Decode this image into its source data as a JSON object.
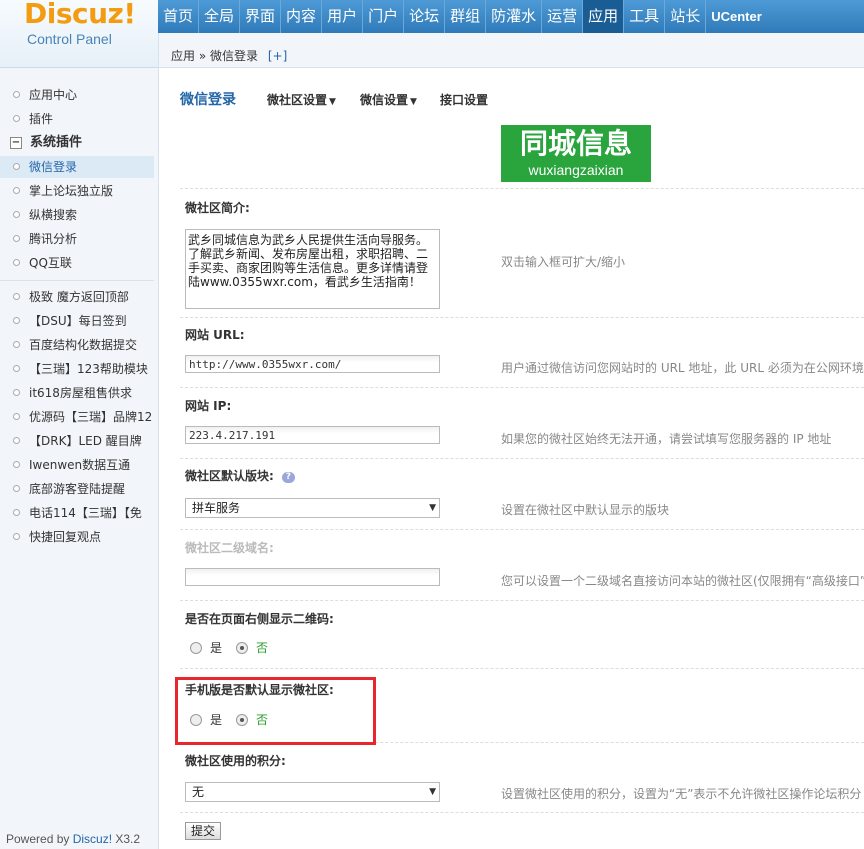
{
  "logo": {
    "brand": "Discuz!",
    "subtitle": "Control Panel"
  },
  "topnav": [
    {
      "label": "首页"
    },
    {
      "label": "全局"
    },
    {
      "label": "界面"
    },
    {
      "label": "内容"
    },
    {
      "label": "用户"
    },
    {
      "label": "门户"
    },
    {
      "label": "论坛"
    },
    {
      "label": "群组"
    },
    {
      "label": "防灌水"
    },
    {
      "label": "运营"
    },
    {
      "label": "应用",
      "active": true
    },
    {
      "label": "工具"
    },
    {
      "label": "站长"
    },
    {
      "label": "UCenter"
    }
  ],
  "breadcrumb": {
    "part1": "应用",
    "sep": "»",
    "part2": "微信登录",
    "plus": "[+]"
  },
  "sidebar": {
    "items_top": [
      "应用中心",
      "插件"
    ],
    "group_label": "系统插件",
    "group_toggle": "−",
    "items_system": [
      "微信登录",
      "掌上论坛独立版",
      "纵横搜索",
      "腾讯分析",
      "QQ互联"
    ],
    "items_plugins": [
      "极致 魔方返回顶部",
      "【DSU】每日签到",
      "百度结构化数据提交",
      "【三瑞】123帮助模块",
      "it618房屋租售供求",
      "优源码【三瑞】品牌12",
      "【DRK】LED 醒目牌",
      "Iwenwen数据互通",
      "底部游客登陆提醒",
      "电话114【三瑞】【免",
      "快捷回复观点"
    ],
    "active": "微信登录"
  },
  "footer": {
    "prefix": "Powered by ",
    "brand": "Discuz!",
    "version": " X3.2"
  },
  "tabs": {
    "current": "微信登录",
    "others": [
      "微社区设置",
      "微信设置",
      "接口设置"
    ],
    "caret": "▼"
  },
  "banner": {
    "line1": "同城信息",
    "line2": "wuxiangzaixian"
  },
  "form": {
    "intro": {
      "label": "微社区简介:",
      "value": "武乡同城信息为武乡人民提供生活向导服务。了解武乡新闻、发布房屋出租，求职招聘、二手买卖、商家团购等生活信息。更多详情请登陆www.0355wxr.com，看武乡生活指南！",
      "tip": "双击输入框可扩大/缩小"
    },
    "url": {
      "label": "网站 URL:",
      "value": "http://www.0355wxr.com/",
      "tip": "用户通过微信访问您网站时的 URL 地址，此 URL 必须为在公网环境"
    },
    "ip": {
      "label": "网站 IP:",
      "value": "223.4.217.191",
      "tip": "如果您的微社区始终无法开通，请尝试填写您服务器的 IP 地址"
    },
    "block": {
      "label": "微社区默认版块:",
      "help": "?",
      "value": "拼车服务",
      "tip": "设置在微社区中默认显示的版块"
    },
    "domain": {
      "label": "微社区二级域名:",
      "value": "",
      "tip": "您可以设置一个二级域名直接访问本站的微社区(仅限拥有“高级接口”"
    },
    "qrcode": {
      "label": "是否在页面右侧显示二维码:",
      "yes": "是",
      "no": "否",
      "selected": "no"
    },
    "mobile": {
      "label": "手机版是否默认显示微社区:",
      "yes": "是",
      "no": "否",
      "selected": "no"
    },
    "credit": {
      "label": "微社区使用的积分:",
      "value": "无",
      "tip": "设置微社区使用的积分，设置为“无”表示不允许微社区操作论坛积分"
    },
    "submit": "提交",
    "select_arrow": "▼"
  },
  "colors": {
    "nav": "#2f7ab8",
    "nav_active": "#1a5d94",
    "accent": "#2366a8",
    "banner": "#2aa53e",
    "highlight": "#e8262e",
    "radio_selected_text": "#2a9d2a"
  }
}
